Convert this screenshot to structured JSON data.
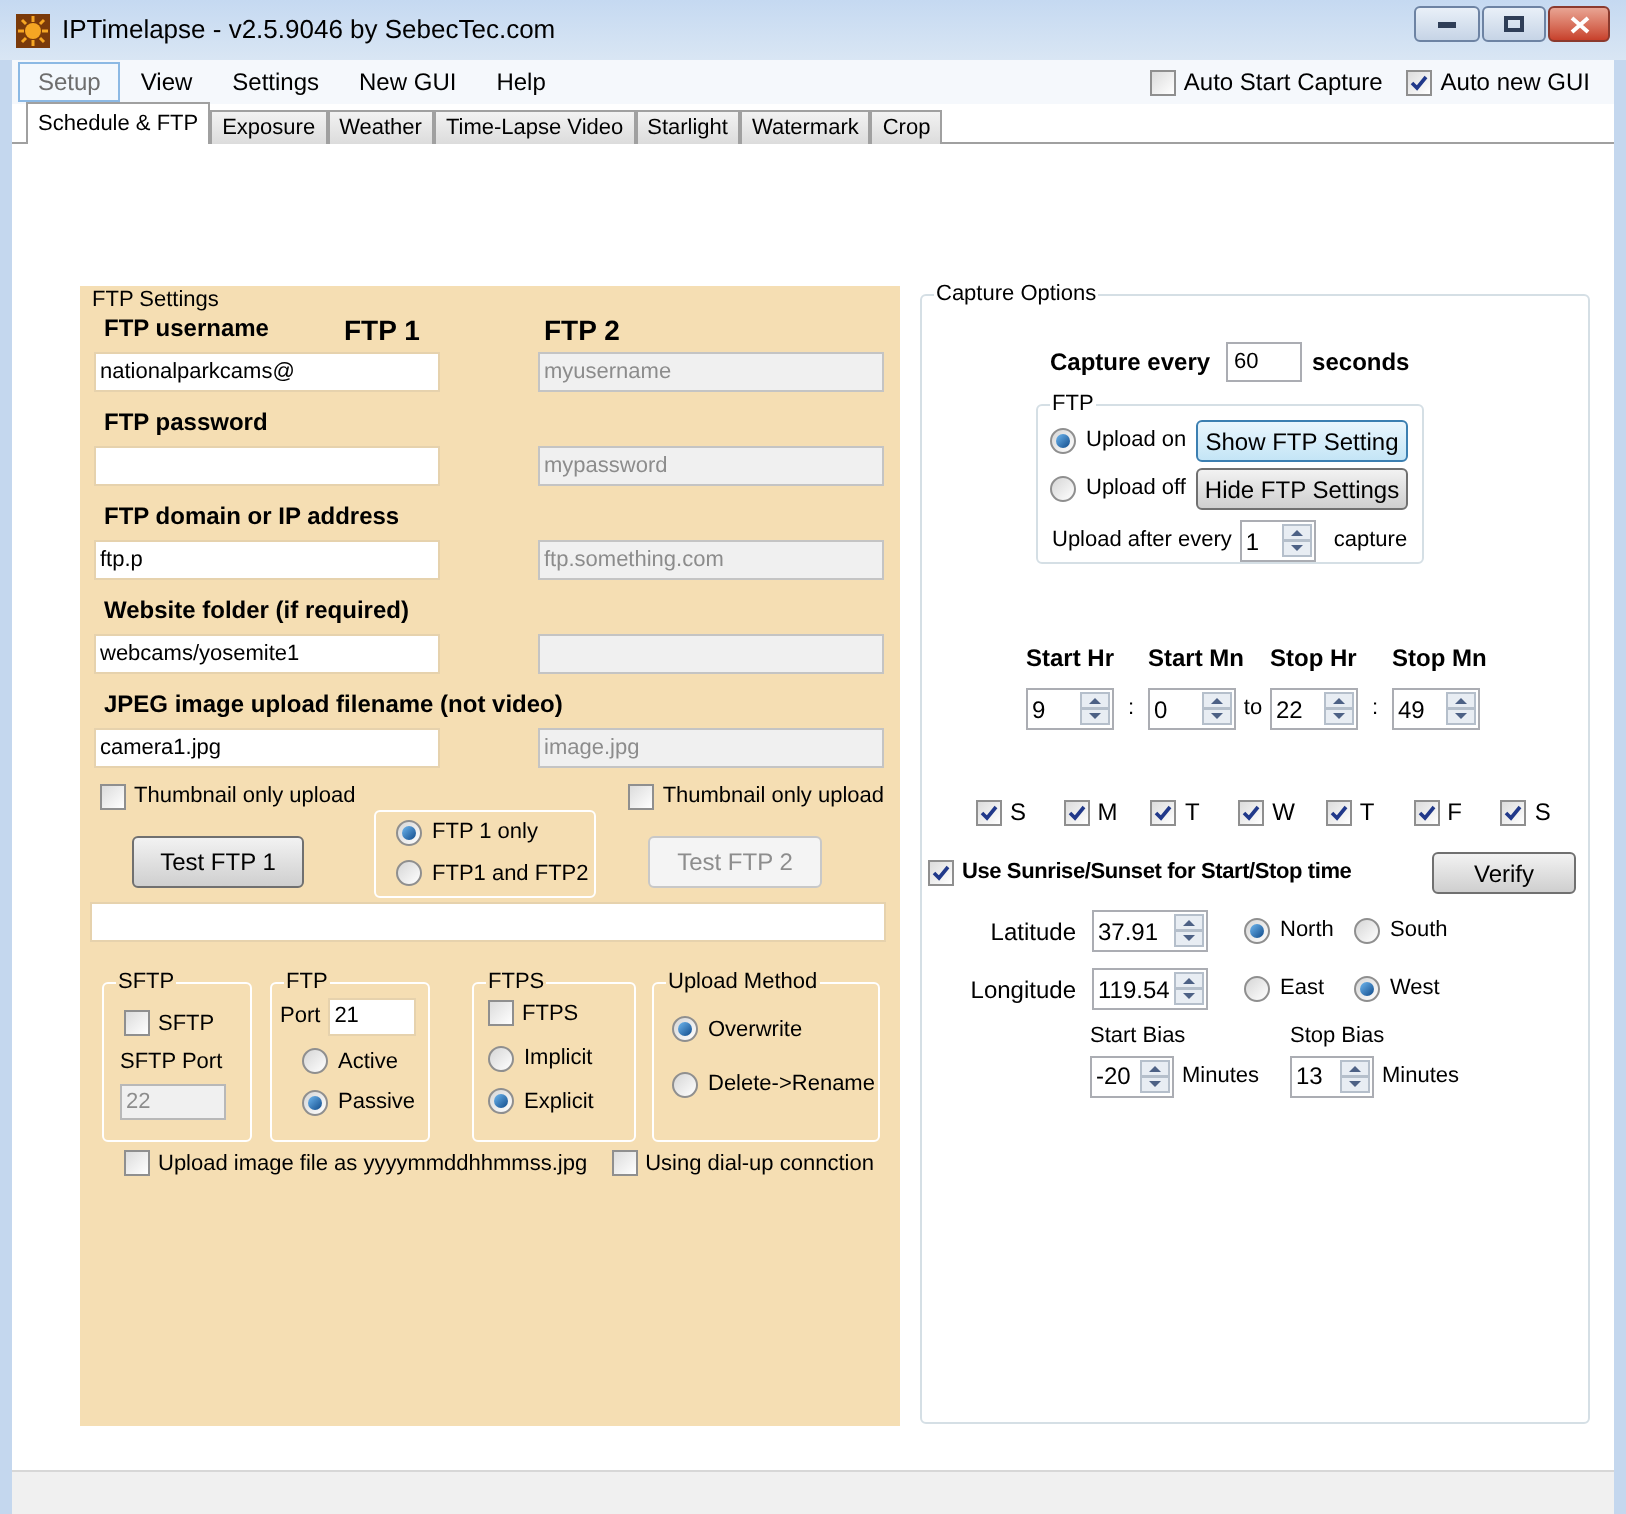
{
  "window": {
    "title": "IPTimelapse - v2.5.9046 by SebecTec.com"
  },
  "menu": [
    {
      "label": "Setup",
      "selected": true
    },
    {
      "label": "View",
      "selected": false
    },
    {
      "label": "Settings",
      "selected": false
    },
    {
      "label": "New GUI",
      "selected": false
    },
    {
      "label": "Help",
      "selected": false
    }
  ],
  "auto_start_capture": {
    "label": "Auto Start Capture",
    "checked": false
  },
  "auto_new_gui": {
    "label": "Auto new GUI",
    "checked": true
  },
  "tabs": [
    {
      "label": "Schedule & FTP",
      "selected": true
    },
    {
      "label": "Exposure",
      "selected": false
    },
    {
      "label": "Weather",
      "selected": false
    },
    {
      "label": "Time-Lapse Video",
      "selected": false
    },
    {
      "label": "Starlight",
      "selected": false
    },
    {
      "label": "Watermark",
      "selected": false
    },
    {
      "label": "Crop",
      "selected": false
    }
  ],
  "ftp_settings": {
    "title": "FTP Settings",
    "ftp1_heading": "FTP 1",
    "ftp2_heading": "FTP 2",
    "rows": [
      {
        "label": "FTP username",
        "ftp1_value": "nationalparkcams@",
        "ftp2_placeholder": "myusername"
      },
      {
        "label": "FTP password",
        "ftp2_placeholder": "mypassword"
      },
      {
        "label": "FTP domain or IP address",
        "ftp1_value": "ftp.p",
        "ftp2_placeholder": "ftp.something.com"
      },
      {
        "label": "Website folder (if required)",
        "ftp1_value": "webcams/yosemite1"
      },
      {
        "label": "JPEG image upload filename (not video)",
        "ftp1_value": "camera1.jpg",
        "ftp2_placeholder": "image.jpg"
      }
    ],
    "thumbnail_ftp1": {
      "label": "Thumbnail only upload",
      "checked": false
    },
    "thumbnail_ftp2": {
      "label": "Thumbnail only upload",
      "checked": false
    },
    "test_ftp1": {
      "label": "Test FTP 1",
      "disabled": false
    },
    "test_ftp2": {
      "label": "Test FTP 2",
      "disabled": true
    },
    "ftp_mode": [
      {
        "label": "FTP 1 only",
        "selected": true
      },
      {
        "label": "FTP1 and FTP2",
        "selected": false
      }
    ],
    "sftp": {
      "title": "SFTP",
      "checkbox": {
        "label": "SFTP",
        "checked": false
      },
      "port_label": "SFTP Port",
      "port_value": "22"
    },
    "ftp": {
      "title": "FTP",
      "port_label": "Port",
      "port_value": "21",
      "modes": [
        {
          "label": "Active",
          "selected": false
        },
        {
          "label": "Passive",
          "selected": true
        }
      ]
    },
    "ftps": {
      "title": "FTPS",
      "checkbox": {
        "label": "FTPS",
        "checked": false
      },
      "modes": [
        {
          "label": "Implicit",
          "selected": false
        },
        {
          "label": "Explicit",
          "selected": true
        }
      ]
    },
    "upload_method": {
      "title": "Upload Method",
      "options": [
        {
          "label": "Overwrite",
          "selected": true
        },
        {
          "label": "Delete->Rename",
          "selected": false
        }
      ]
    },
    "upload_as_timestamp": {
      "label": "Upload image file as yyyymmddhhmmss.jpg",
      "checked": false
    },
    "dial_up": {
      "label": "Using dial-up connction",
      "checked": false
    }
  },
  "capture_options": {
    "title": "Capture Options",
    "capture_every": {
      "label": "Capture every",
      "value": "60",
      "unit": "seconds"
    },
    "ftp": {
      "title": "FTP",
      "upload": [
        {
          "label": "Upload on",
          "selected": true
        },
        {
          "label": "Upload off",
          "selected": false
        }
      ],
      "show_button": {
        "label": "Show  FTP Setting",
        "focused": true
      },
      "hide_button": {
        "label": "Hide FTP Settings",
        "focused": false
      },
      "upload_after": {
        "label": "Upload after every",
        "value": "1",
        "unit": "capture"
      }
    },
    "schedule": [
      {
        "label": "Start Hr",
        "value": "9",
        "separator": ":"
      },
      {
        "label": "Start Mn",
        "value": "0",
        "separator": "to"
      },
      {
        "label": "Stop Hr",
        "value": "22",
        "separator": ":"
      },
      {
        "label": "Stop Mn",
        "value": "49"
      }
    ],
    "days": [
      {
        "label": "S",
        "checked": true
      },
      {
        "label": "M",
        "checked": true
      },
      {
        "label": "T",
        "checked": true
      },
      {
        "label": "W",
        "checked": true
      },
      {
        "label": "T",
        "checked": true
      },
      {
        "label": "F",
        "checked": true
      },
      {
        "label": "S",
        "checked": true
      }
    ],
    "use_sunrise": {
      "label": "Use Sunrise/Sunset for Start/Stop time",
      "checked": true
    },
    "verify_button": "Verify",
    "coordinates": [
      {
        "label": "Latitude",
        "value": "37.91",
        "options": [
          {
            "label": "North",
            "selected": true
          },
          {
            "label": "South",
            "selected": false
          }
        ]
      },
      {
        "label": "Longitude",
        "value": "119.54",
        "options": [
          {
            "label": "East",
            "selected": false
          },
          {
            "label": "West",
            "selected": true
          }
        ]
      }
    ],
    "bias": [
      {
        "label": "Start Bias",
        "value": "-20",
        "unit": "Minutes"
      },
      {
        "label": "Stop Bias",
        "value": "13",
        "unit": "Minutes"
      }
    ]
  }
}
